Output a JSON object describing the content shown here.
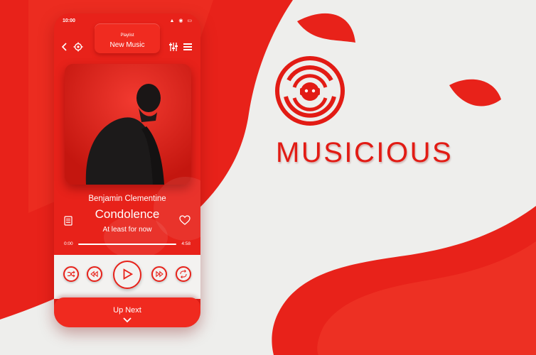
{
  "status": {
    "time": "10:00"
  },
  "header": {
    "playlist_label": "Playlist",
    "playlist_name": "New Music"
  },
  "track": {
    "artist": "Benjamin Clementine",
    "title": "Condolence",
    "subtitle": "At least for now",
    "time_elapsed": "0:00",
    "time_total": "4:58",
    "progress": 0.0
  },
  "footer": {
    "up_next_label": "Up Next"
  },
  "brand": {
    "name": "MUSICIOUS"
  },
  "colors": {
    "accent": "#e8221a",
    "light": "#f3f2f0",
    "background": "#eeeeec"
  },
  "icons": [
    "back-icon",
    "settings-icon",
    "equalizer-icon",
    "menu-icon",
    "lyrics-icon",
    "heart-icon",
    "shuffle-icon",
    "rewind-icon",
    "play-icon",
    "fast-forward-icon",
    "repeat-icon",
    "chevron-down-icon"
  ]
}
